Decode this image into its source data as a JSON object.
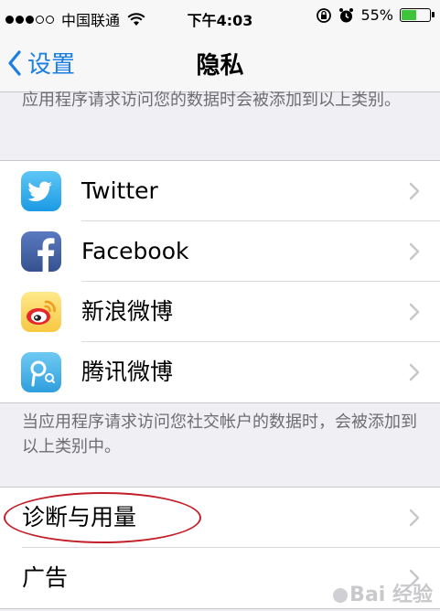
{
  "status": {
    "carrier": "中国联通",
    "time": "下午4:03",
    "battery_text": "55%",
    "battery_level": 0.55,
    "battery_color": "#3ec43b"
  },
  "nav": {
    "back_label": "设置",
    "title": "隐私",
    "accent": "#1a7ee3"
  },
  "notes": {
    "top": "应用程序请求访问您的数据时会被添加到以上类别。",
    "social": "当应用程序请求访问您社交帐户的数据时，会被添加到以上类别中。"
  },
  "social_accounts": [
    {
      "label": "Twitter",
      "icon": "twitter-icon"
    },
    {
      "label": "Facebook",
      "icon": "facebook-icon"
    },
    {
      "label": "新浪微博",
      "icon": "sina-weibo-icon"
    },
    {
      "label": "腾讯微博",
      "icon": "tencent-weibo-icon"
    }
  ],
  "other_items": [
    {
      "label": "诊断与用量"
    },
    {
      "label": "广告"
    }
  ],
  "watermark": "Bai 经验"
}
